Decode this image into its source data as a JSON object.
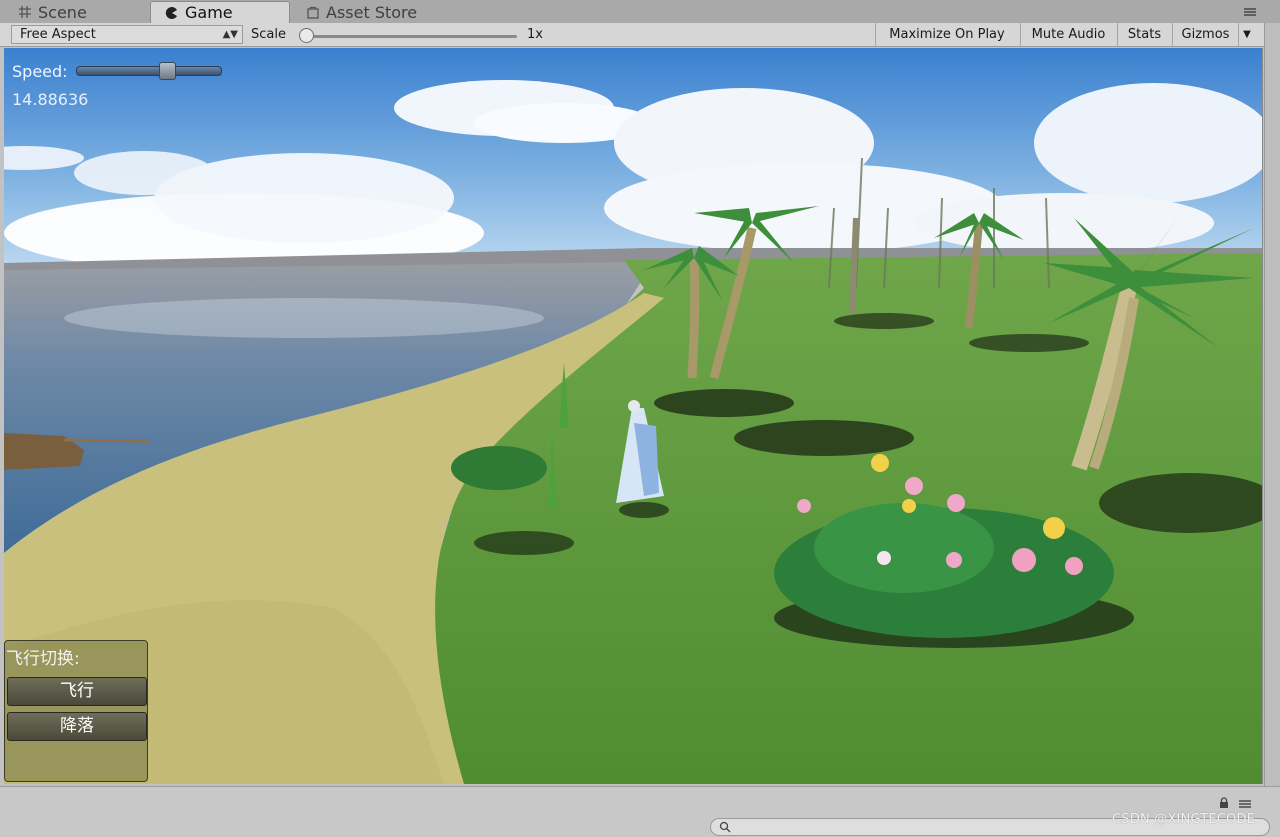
{
  "tabs": [
    {
      "label": "Scene",
      "icon": "grid-icon"
    },
    {
      "label": "Game",
      "icon": "pacman-icon"
    },
    {
      "label": "Asset Store",
      "icon": "store-bag-icon"
    }
  ],
  "toolbar": {
    "aspect": "Free Aspect",
    "scale_label": "Scale",
    "scale_value": "1x",
    "maximize": "Maximize On Play",
    "mute": "Mute Audio",
    "stats": "Stats",
    "gizmos": "Gizmos"
  },
  "hud": {
    "speed_label": "Speed:",
    "speed_value": "14.88636",
    "speed_slider_level": 0.63
  },
  "fly_panel": {
    "title": "飞行切换:",
    "fly_button": "飞行",
    "land_button": "降落"
  },
  "watermark": "CSDN @XINGTECODE",
  "colors": {
    "sky_top": "#3f86d4",
    "grass": "#5d9a3a",
    "sand": "#c9c07e",
    "water": "#4d76a0"
  }
}
